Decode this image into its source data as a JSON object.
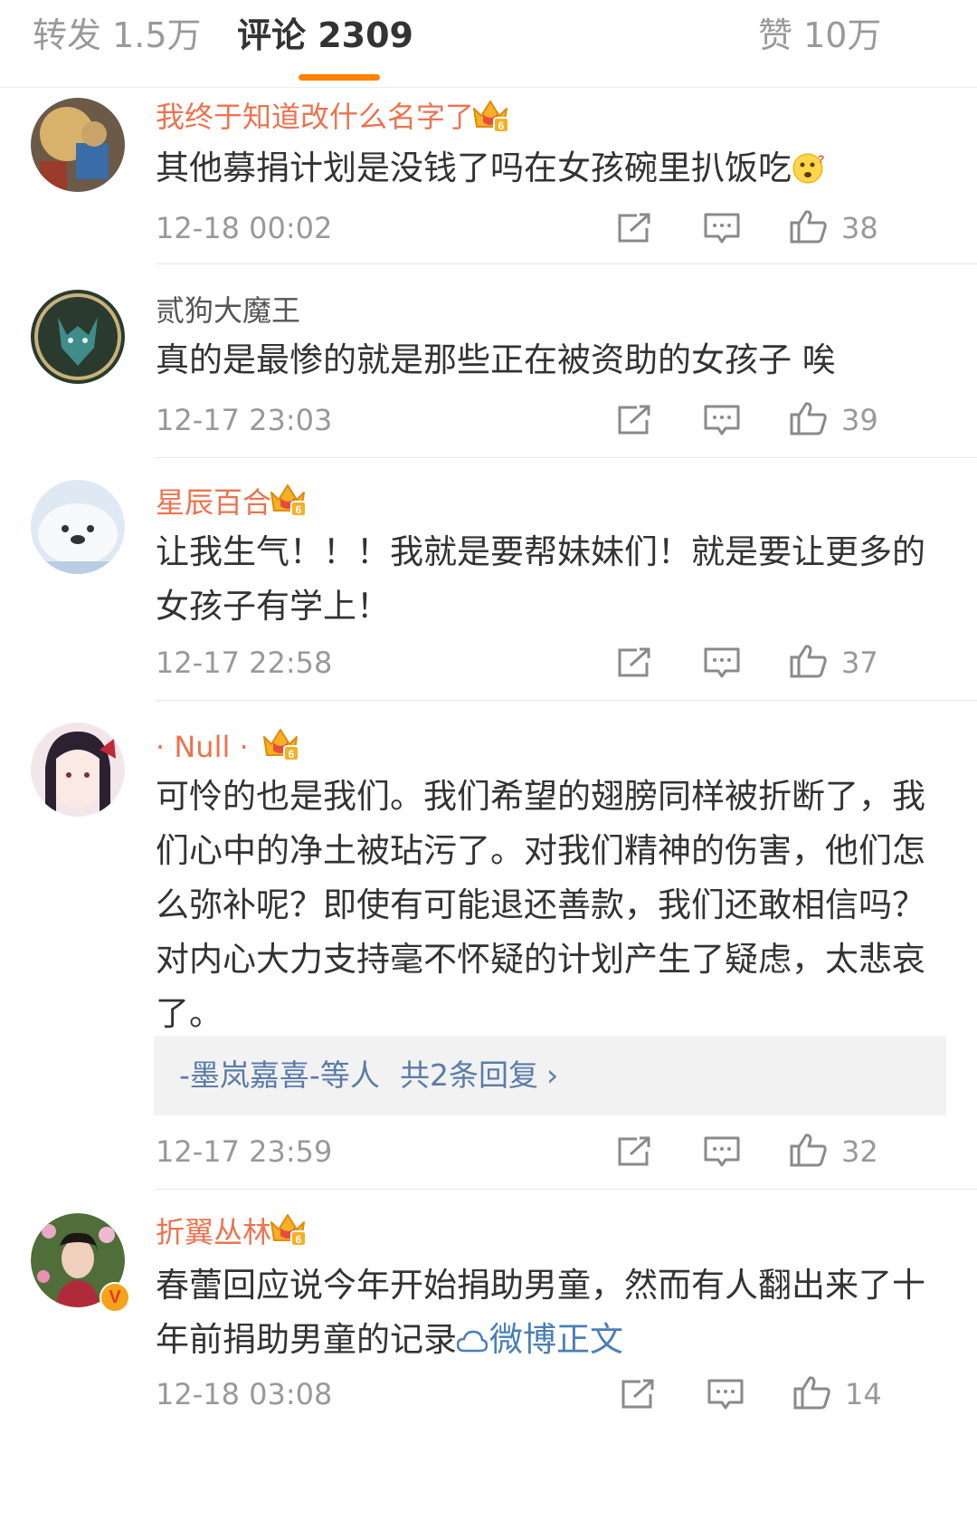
{
  "tabs": {
    "repost": "转发 1.5万",
    "comments": "评论 2309",
    "likes": "赞 10万"
  },
  "colors": {
    "accent": "#ff8200",
    "username_vip": "#eb7350",
    "link": "#4a7fb5",
    "meta": "#999999",
    "text": "#333333"
  },
  "comments": [
    {
      "username": "我终于知道改什么名字了",
      "badge": "crown-badge",
      "content": "其他募捐计划是没钱了吗在女孩碗里扒饭吃",
      "emoji": "thinking-emoji",
      "time": "12-18 00:02",
      "likes": "38"
    },
    {
      "username": "贰狗大魔王",
      "content": "真的是最惨的就是那些正在被资助的女孩子 唉",
      "time": "12-17 23:03",
      "likes": "39"
    },
    {
      "username": "星辰百合",
      "badge": "crown-badge",
      "content": "让我生气！！！我就是要帮妹妹们！就是要让更多的女孩子有学上！",
      "time": "12-17 22:58",
      "likes": "37"
    },
    {
      "username": "· Null ·",
      "badge": "crown-badge",
      "content": "可怜的也是我们。我们希望的翅膀同样被折断了，我们心中的净土被玷污了。对我们精神的伤害，他们怎么弥补呢？即使有可能退还善款，我们还敢相信吗？对内心大力支持毫不怀疑的计划产生了疑虑，太悲哀了。",
      "replies": {
        "who": "-墨岚嘉喜-等人",
        "link": "共2条回复",
        "chevron": "›"
      },
      "time": "12-17 23:59",
      "likes": "32"
    },
    {
      "username": "折翼丛林",
      "badge": "crown-badge",
      "verified": "V",
      "content": "春蕾回应说今年开始捐助男童，然而有人翻出来了十年前捐助男童的记录",
      "link_text": "微博正文",
      "time": "12-18 03:08",
      "likes": "14"
    }
  ]
}
